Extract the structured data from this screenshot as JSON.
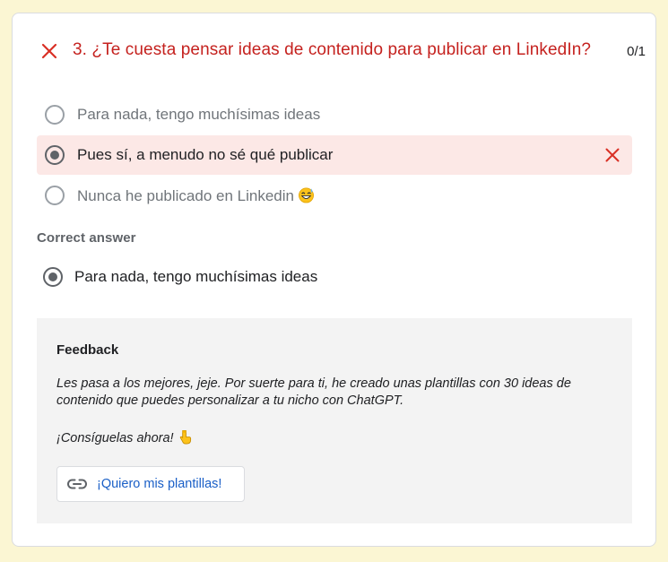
{
  "question": {
    "title": "3. ¿Te cuesta pensar ideas de contenido para publicar en LinkedIn?",
    "score": "0/1",
    "status_icon": "close-icon"
  },
  "options": [
    {
      "label": "Para nada, tengo muchísimas ideas",
      "selected": false
    },
    {
      "label": "Pues sí, a menudo no sé qué publicar",
      "selected": true,
      "incorrect": true
    },
    {
      "label": "Nunca he publicado en Linkedin",
      "selected": false,
      "emoji": "grinning-sweat-emoji"
    }
  ],
  "correct": {
    "heading": "Correct answer",
    "answer": "Para nada, tengo muchísimas ideas"
  },
  "feedback": {
    "title": "Feedback",
    "text": "Les pasa a los mejores, jeje. Por suerte para ti, he creado unas plantillas con 30 ideas de contenido que puedes personalizar a tu nicho con ChatGPT.",
    "cta": "¡Consíguelas ahora!",
    "cta_emoji": "pointing-down-emoji",
    "link_label": "¡Quiero mis plantillas!",
    "link_icon": "link-icon"
  },
  "colors": {
    "error": "#c5221f",
    "error_bg": "#fce8e6",
    "page_bg": "#fbf6d3",
    "link": "#1a5fc7"
  }
}
